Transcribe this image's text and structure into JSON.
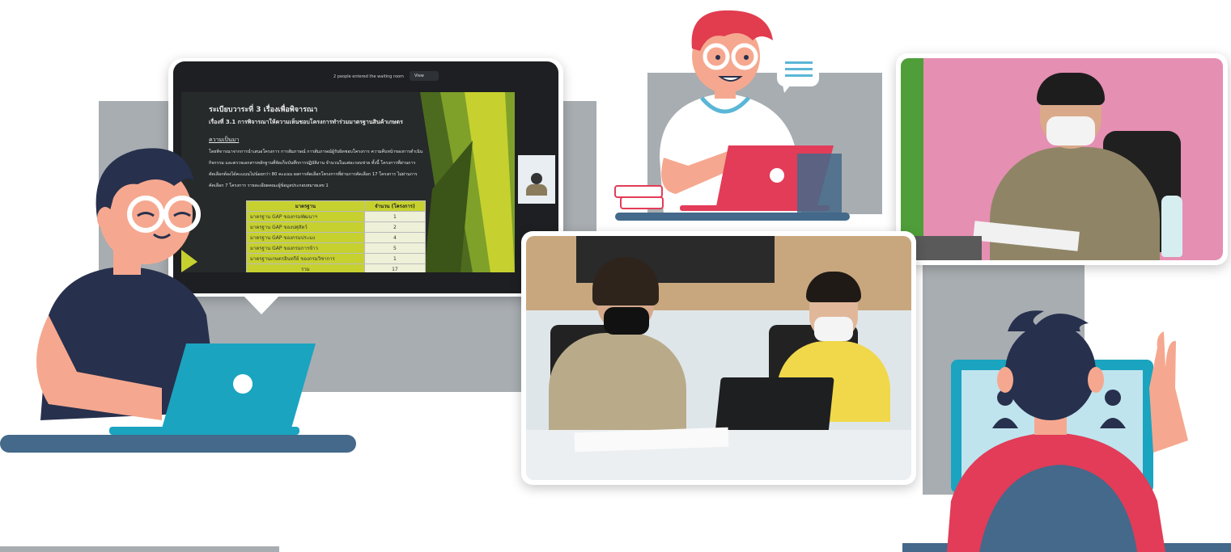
{
  "presentation": {
    "zoom_bar_text": "2 people entered the waiting room",
    "zoom_bar_button": "View",
    "slide_title": "ระเบียบวาระที่ 3    เรื่องเพื่อพิจารณา",
    "slide_subtitle": "เรื่องที่ 3.1  การพิจารณาให้ความเห็นชอบโครงการทำร่วมมาตรฐานสินค้าเกษตร",
    "section_heading": "ความเป็นมา",
    "body_lines": [
      "โดยพิจารณาจากการนำเสนอโครงการ การสัมภาษณ์ การสัมภาษณ์ผู้รับผิดชอบโครงการ ความคืบหน้าของการดำเนิน",
      "กิจกรรม และตรวจเอกสารหลักฐานที่จัดเก็บบันทึกการปฏิบัติงาน จำนวนในแต่ละรอบข่าย ทั้งนี้ โครงการที่ผ่านการ",
      "คัดเลือกต้องได้คะแนนไม่น้อยกว่า 80 คะแนน ผลการคัดเลือกโครงการที่ผ่านการคัดเลือก 17 โครงการ ไม่ผ่านการ",
      "คัดเลือก 7 โครงการ รายละเอียดคณะผู้ข้อมูลประกอบหมายเลข 1"
    ],
    "table": {
      "headers": [
        "มาตรฐาน",
        "จำนวน (โครงการ)"
      ],
      "rows": [
        [
          "มาตรฐาน GAP ของกรมพัฒนาฯ",
          "1"
        ],
        [
          "มาตรฐาน GAP ของปศุสัตว์",
          "2"
        ],
        [
          "มาตรฐาน GAP ของกรมประมง",
          "4"
        ],
        [
          "มาตรฐาน GAP ของกรมการข้าว",
          "5"
        ],
        [
          "มาตรฐานเกษตรอินทรีย์ ของกรมวิชาการ",
          "1"
        ]
      ],
      "total_label": "รวม",
      "total_value": "17"
    }
  },
  "colors": {
    "gray_panel": "#a8adb1",
    "desk_blue": "#44698a",
    "laptop_teal": "#1aa4c0",
    "laptop_red": "#e23c58",
    "skin": "#f5a88f",
    "hair_navy": "#27304d",
    "hair_red": "#e23c4f",
    "slide_green": "#c6d12f"
  },
  "icons": {
    "chat_bubble": "chat-bubble-icon",
    "participant": "participant-icon"
  }
}
